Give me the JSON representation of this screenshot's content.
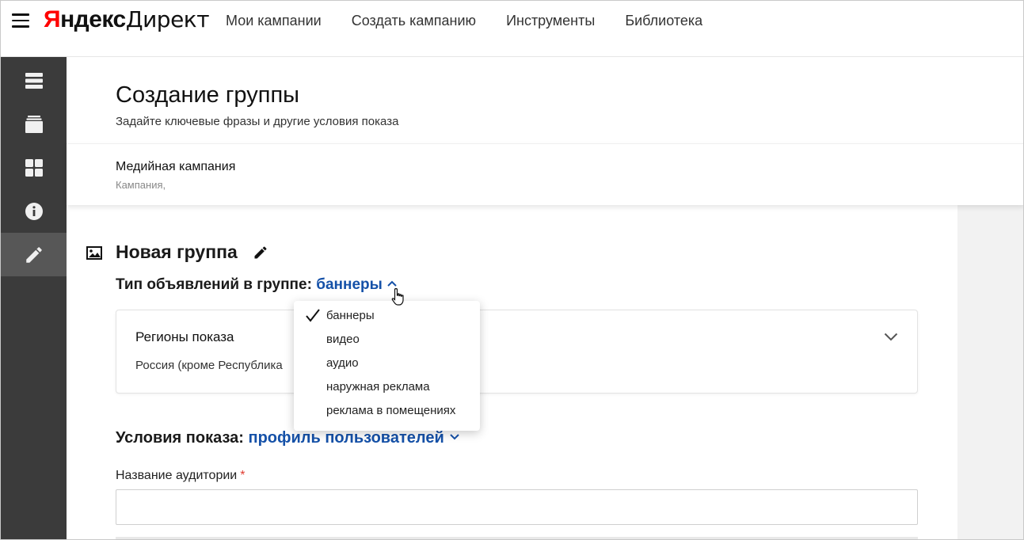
{
  "header": {
    "logo_brand_first": "Я",
    "logo_brand_rest": "ндекс",
    "logo_product": "Директ",
    "nav": [
      {
        "label": "Мои кампании"
      },
      {
        "label": "Создать кампанию"
      },
      {
        "label": "Инструменты"
      },
      {
        "label": "Библиотека"
      }
    ]
  },
  "sidebar": {
    "items": [
      {
        "icon": "list-icon"
      },
      {
        "icon": "layers-icon"
      },
      {
        "icon": "grid-icon"
      },
      {
        "icon": "info-icon"
      },
      {
        "icon": "pencil-icon",
        "active": true
      }
    ]
  },
  "page": {
    "title": "Создание группы",
    "subtitle": "Задайте ключевые фразы и другие условия показа"
  },
  "campaign": {
    "name": "Медийная кампания",
    "sub": "Кампания,"
  },
  "group": {
    "title": "Новая группа",
    "type_label": "Тип объявлений в группе:",
    "type_value": "баннеры"
  },
  "regions": {
    "title": "Регионы показа",
    "value": "Россия (кроме Республика"
  },
  "conditions": {
    "label": "Условия показа:",
    "value": "профиль пользователей"
  },
  "audience": {
    "label": "Название аудитории",
    "required_mark": "*",
    "value": "",
    "placeholder": ""
  },
  "dropdown": {
    "items": [
      {
        "label": "баннеры",
        "selected": true
      },
      {
        "label": "видео"
      },
      {
        "label": "аудио"
      },
      {
        "label": "наружная реклама"
      },
      {
        "label": "реклама в помещениях"
      }
    ]
  },
  "colors": {
    "link": "#1551a8",
    "sidebar_bg": "#3b3b3b",
    "sidebar_active": "#575757",
    "required": "#e03c31",
    "logo_red": "#ff0000"
  }
}
